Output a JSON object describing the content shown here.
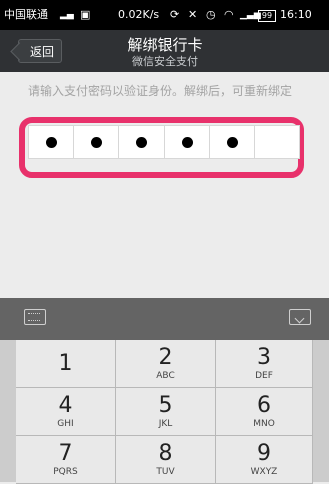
{
  "status_bar": {
    "carrier": "中国联通",
    "network_speed": "0.02K/s",
    "battery": "99",
    "time": "16:10"
  },
  "nav": {
    "back_label": "返回",
    "title": "解绑银行卡",
    "subtitle": "微信安全支付"
  },
  "hint": "请输入支付密码以验证身份。解绑后，可重新绑定",
  "pin": {
    "length": 6,
    "filled": 5
  },
  "highlight_color": "#e8316b",
  "keypad": {
    "keys": [
      {
        "num": "1",
        "sub": ""
      },
      {
        "num": "2",
        "sub": "ABC"
      },
      {
        "num": "3",
        "sub": "DEF"
      },
      {
        "num": "4",
        "sub": "GHI"
      },
      {
        "num": "5",
        "sub": "JKL"
      },
      {
        "num": "6",
        "sub": "MNO"
      },
      {
        "num": "7",
        "sub": "PQRS"
      },
      {
        "num": "8",
        "sub": "TUV"
      },
      {
        "num": "9",
        "sub": "WXYZ"
      }
    ]
  }
}
